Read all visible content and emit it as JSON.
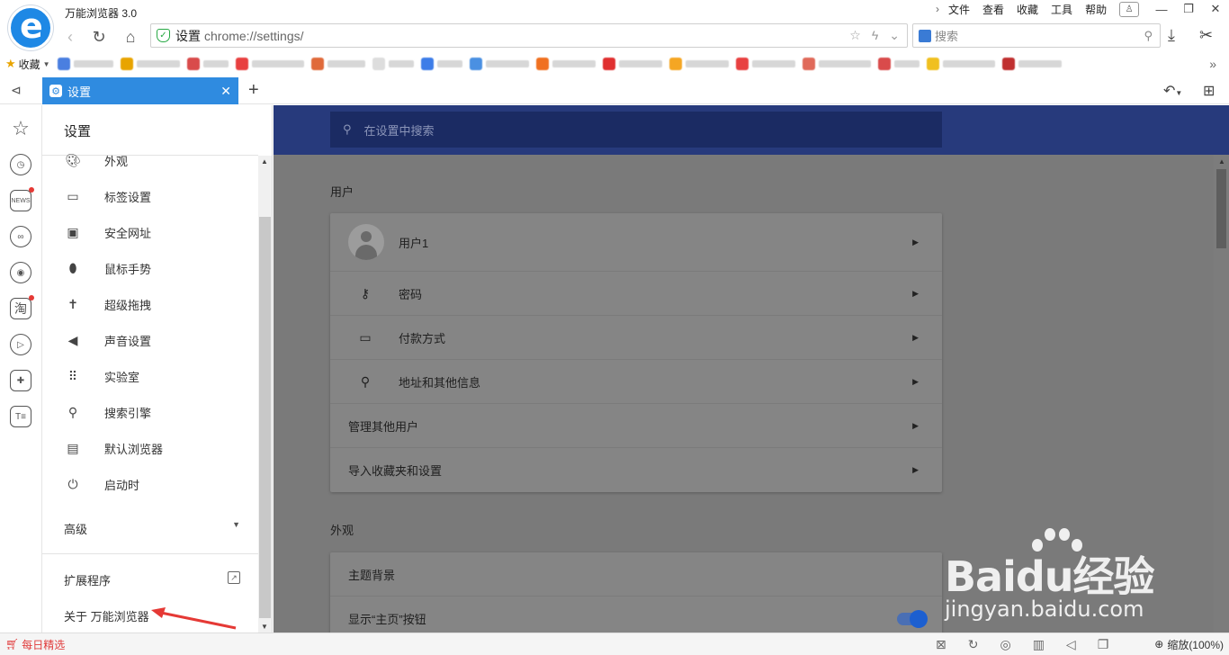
{
  "app": {
    "title": "万能浏览器 3.0"
  },
  "menu": {
    "items": [
      "文件",
      "查看",
      "收藏",
      "工具",
      "帮助"
    ]
  },
  "address": {
    "label": "设置",
    "url": "chrome://settings/"
  },
  "search": {
    "placeholder": "搜索"
  },
  "bookmarks": {
    "favorites_label": "收藏"
  },
  "tab": {
    "title": "设置"
  },
  "settings_menu": {
    "title": "设置",
    "items": [
      {
        "label": "外观",
        "icon": "palette-icon"
      },
      {
        "label": "标签设置",
        "icon": "clipboard-icon"
      },
      {
        "label": "安全网址",
        "icon": "monitor-check-icon"
      },
      {
        "label": "鼠标手势",
        "icon": "mouse-icon"
      },
      {
        "label": "超级拖拽",
        "icon": "accessibility-icon"
      },
      {
        "label": "声音设置",
        "icon": "volume-icon"
      },
      {
        "label": "实验室",
        "icon": "grid-icon"
      },
      {
        "label": "搜索引擎",
        "icon": "search-icon"
      },
      {
        "label": "默认浏览器",
        "icon": "browser-window-icon"
      },
      {
        "label": "启动时",
        "icon": "power-icon"
      }
    ],
    "advanced": "高级",
    "extensions": "扩展程序",
    "about": "关于 万能浏览器"
  },
  "content": {
    "search_placeholder": "在设置中搜索",
    "users_section": {
      "title": "用户",
      "rows": [
        {
          "label": "用户1",
          "icon": "avatar"
        },
        {
          "label": "密码",
          "icon": "key-icon"
        },
        {
          "label": "付款方式",
          "icon": "credit-card-icon"
        },
        {
          "label": "地址和其他信息",
          "icon": "location-pin-icon"
        },
        {
          "label": "管理其他用户",
          "icon": ""
        },
        {
          "label": "导入收藏夹和设置",
          "icon": ""
        }
      ]
    },
    "appearance_section": {
      "title": "外观",
      "rows": [
        {
          "label": "主题背景"
        },
        {
          "label": "显示“主页”按钮"
        }
      ],
      "home_button_enabled": true
    }
  },
  "statusbar": {
    "daily": "每日精选",
    "zoom": "缩放(100%)"
  },
  "watermark": {
    "brand": "Baidu经验",
    "site": "jingyan.baidu.com"
  },
  "colors": {
    "accent": "#2f8be0",
    "header": "#273a7c",
    "overlay": "#7a7a7a",
    "annotation": "#e53935"
  }
}
